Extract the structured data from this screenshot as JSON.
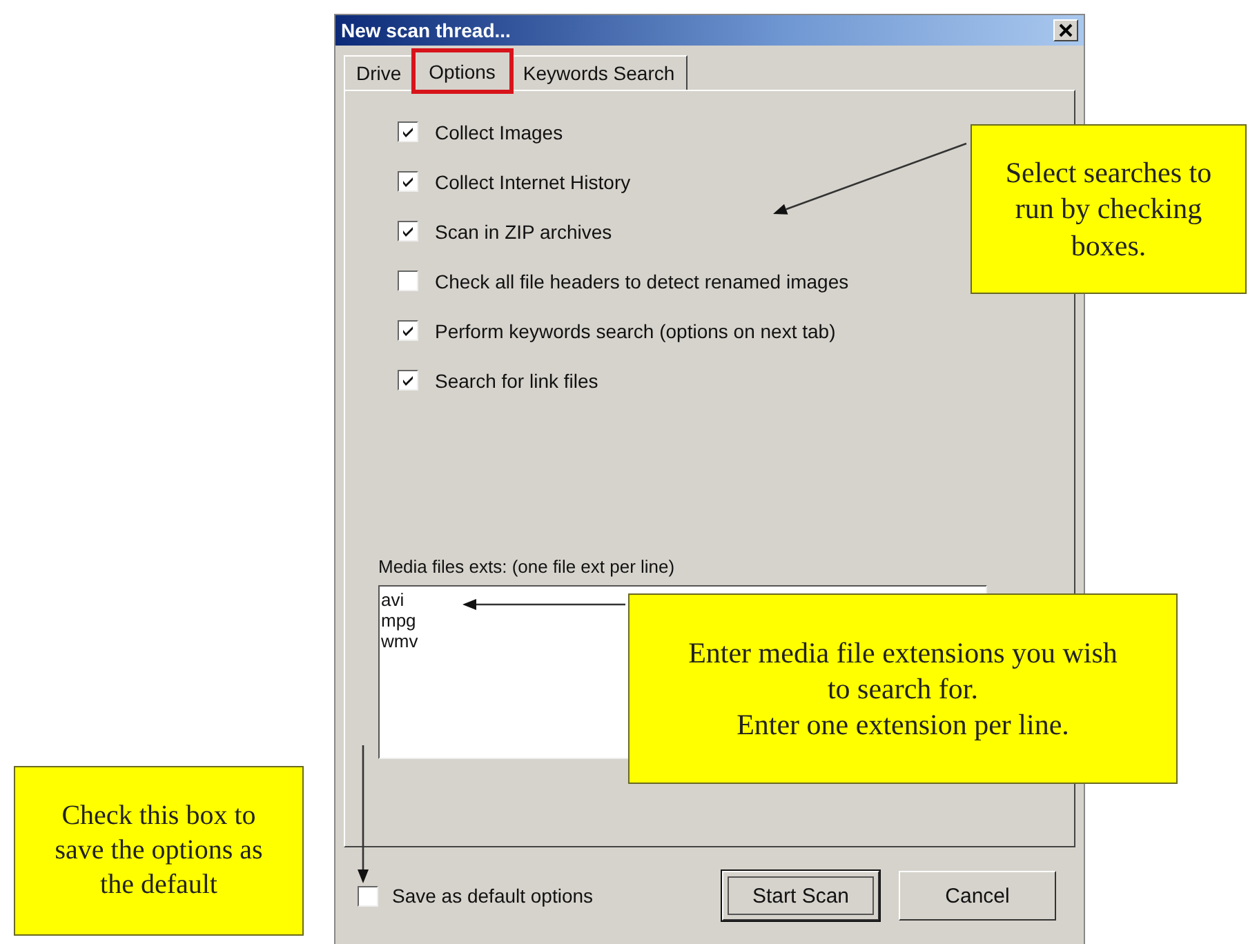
{
  "window": {
    "title": "New scan thread..."
  },
  "tabs": [
    {
      "label": "Drive",
      "selected": false,
      "highlighted": false
    },
    {
      "label": "Options",
      "selected": true,
      "highlighted": true
    },
    {
      "label": "Keywords Search",
      "selected": false,
      "highlighted": false
    }
  ],
  "options": [
    {
      "label": "Collect Images",
      "checked": true
    },
    {
      "label": "Collect Internet History",
      "checked": true
    },
    {
      "label": "Scan in ZIP archives",
      "checked": true
    },
    {
      "label": "Check all file headers to detect renamed images",
      "checked": false
    },
    {
      "label": "Perform keywords search (options on next tab)",
      "checked": true
    },
    {
      "label": "Search for link files",
      "checked": true
    }
  ],
  "media": {
    "label": "Media files exts: (one file ext per line)",
    "value": "avi\nmpg\nwmv"
  },
  "save_default": {
    "label": "Save as default options",
    "checked": false
  },
  "buttons": [
    {
      "label": "Start Scan",
      "default": true
    },
    {
      "label": "Cancel",
      "default": false
    }
  ],
  "callouts": [
    {
      "text": "Select searches to run by checking boxes."
    },
    {
      "text": "Enter media file extensions you wish to search for.\nEnter one extension per line."
    },
    {
      "text": "Check this box to save the options as the default"
    }
  ]
}
